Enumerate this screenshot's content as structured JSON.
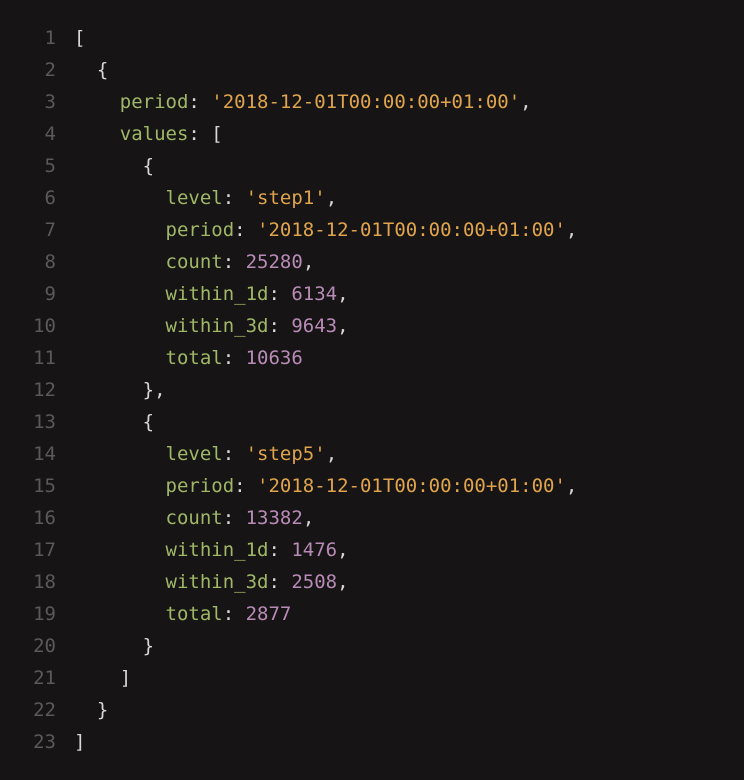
{
  "code": {
    "lines": [
      {
        "num": "1",
        "indent": 0,
        "tokens": [
          {
            "t": "punc",
            "v": "["
          }
        ]
      },
      {
        "num": "2",
        "indent": 1,
        "tokens": [
          {
            "t": "punc",
            "v": "{"
          }
        ]
      },
      {
        "num": "3",
        "indent": 2,
        "tokens": [
          {
            "t": "key",
            "v": "period"
          },
          {
            "t": "colon",
            "v": ": "
          },
          {
            "t": "str",
            "v": "'2018-12-01T00:00:00+01:00'"
          },
          {
            "t": "punc",
            "v": ","
          }
        ]
      },
      {
        "num": "4",
        "indent": 2,
        "tokens": [
          {
            "t": "key",
            "v": "values"
          },
          {
            "t": "colon",
            "v": ": "
          },
          {
            "t": "punc",
            "v": "["
          }
        ]
      },
      {
        "num": "5",
        "indent": 3,
        "tokens": [
          {
            "t": "punc",
            "v": "{"
          }
        ]
      },
      {
        "num": "6",
        "indent": 4,
        "tokens": [
          {
            "t": "key",
            "v": "level"
          },
          {
            "t": "colon",
            "v": ": "
          },
          {
            "t": "str",
            "v": "'step1'"
          },
          {
            "t": "punc",
            "v": ","
          }
        ]
      },
      {
        "num": "7",
        "indent": 4,
        "tokens": [
          {
            "t": "key",
            "v": "period"
          },
          {
            "t": "colon",
            "v": ": "
          },
          {
            "t": "str",
            "v": "'2018-12-01T00:00:00+01:00'"
          },
          {
            "t": "punc",
            "v": ","
          }
        ]
      },
      {
        "num": "8",
        "indent": 4,
        "tokens": [
          {
            "t": "key",
            "v": "count"
          },
          {
            "t": "colon",
            "v": ": "
          },
          {
            "t": "num",
            "v": "25280"
          },
          {
            "t": "punc",
            "v": ","
          }
        ]
      },
      {
        "num": "9",
        "indent": 4,
        "tokens": [
          {
            "t": "key",
            "v": "within_1d"
          },
          {
            "t": "colon",
            "v": ": "
          },
          {
            "t": "num",
            "v": "6134"
          },
          {
            "t": "punc",
            "v": ","
          }
        ]
      },
      {
        "num": "10",
        "indent": 4,
        "tokens": [
          {
            "t": "key",
            "v": "within_3d"
          },
          {
            "t": "colon",
            "v": ": "
          },
          {
            "t": "num",
            "v": "9643"
          },
          {
            "t": "punc",
            "v": ","
          }
        ]
      },
      {
        "num": "11",
        "indent": 4,
        "tokens": [
          {
            "t": "key",
            "v": "total"
          },
          {
            "t": "colon",
            "v": ": "
          },
          {
            "t": "num",
            "v": "10636"
          }
        ]
      },
      {
        "num": "12",
        "indent": 3,
        "tokens": [
          {
            "t": "punc",
            "v": "},"
          }
        ]
      },
      {
        "num": "13",
        "indent": 3,
        "tokens": [
          {
            "t": "punc",
            "v": "{"
          }
        ]
      },
      {
        "num": "14",
        "indent": 4,
        "tokens": [
          {
            "t": "key",
            "v": "level"
          },
          {
            "t": "colon",
            "v": ": "
          },
          {
            "t": "str",
            "v": "'step5'"
          },
          {
            "t": "punc",
            "v": ","
          }
        ]
      },
      {
        "num": "15",
        "indent": 4,
        "tokens": [
          {
            "t": "key",
            "v": "period"
          },
          {
            "t": "colon",
            "v": ": "
          },
          {
            "t": "str",
            "v": "'2018-12-01T00:00:00+01:00'"
          },
          {
            "t": "punc",
            "v": ","
          }
        ]
      },
      {
        "num": "16",
        "indent": 4,
        "tokens": [
          {
            "t": "key",
            "v": "count"
          },
          {
            "t": "colon",
            "v": ": "
          },
          {
            "t": "num",
            "v": "13382"
          },
          {
            "t": "punc",
            "v": ","
          }
        ]
      },
      {
        "num": "17",
        "indent": 4,
        "tokens": [
          {
            "t": "key",
            "v": "within_1d"
          },
          {
            "t": "colon",
            "v": ": "
          },
          {
            "t": "num",
            "v": "1476"
          },
          {
            "t": "punc",
            "v": ","
          }
        ]
      },
      {
        "num": "18",
        "indent": 4,
        "tokens": [
          {
            "t": "key",
            "v": "within_3d"
          },
          {
            "t": "colon",
            "v": ": "
          },
          {
            "t": "num",
            "v": "2508"
          },
          {
            "t": "punc",
            "v": ","
          }
        ]
      },
      {
        "num": "19",
        "indent": 4,
        "tokens": [
          {
            "t": "key",
            "v": "total"
          },
          {
            "t": "colon",
            "v": ": "
          },
          {
            "t": "num",
            "v": "2877"
          }
        ]
      },
      {
        "num": "20",
        "indent": 3,
        "tokens": [
          {
            "t": "punc",
            "v": "}"
          }
        ]
      },
      {
        "num": "21",
        "indent": 2,
        "tokens": [
          {
            "t": "punc",
            "v": "]"
          }
        ]
      },
      {
        "num": "22",
        "indent": 1,
        "tokens": [
          {
            "t": "punc",
            "v": "}"
          }
        ]
      },
      {
        "num": "23",
        "indent": 0,
        "tokens": [
          {
            "t": "punc",
            "v": "]"
          }
        ]
      }
    ],
    "indent_unit": "  "
  }
}
